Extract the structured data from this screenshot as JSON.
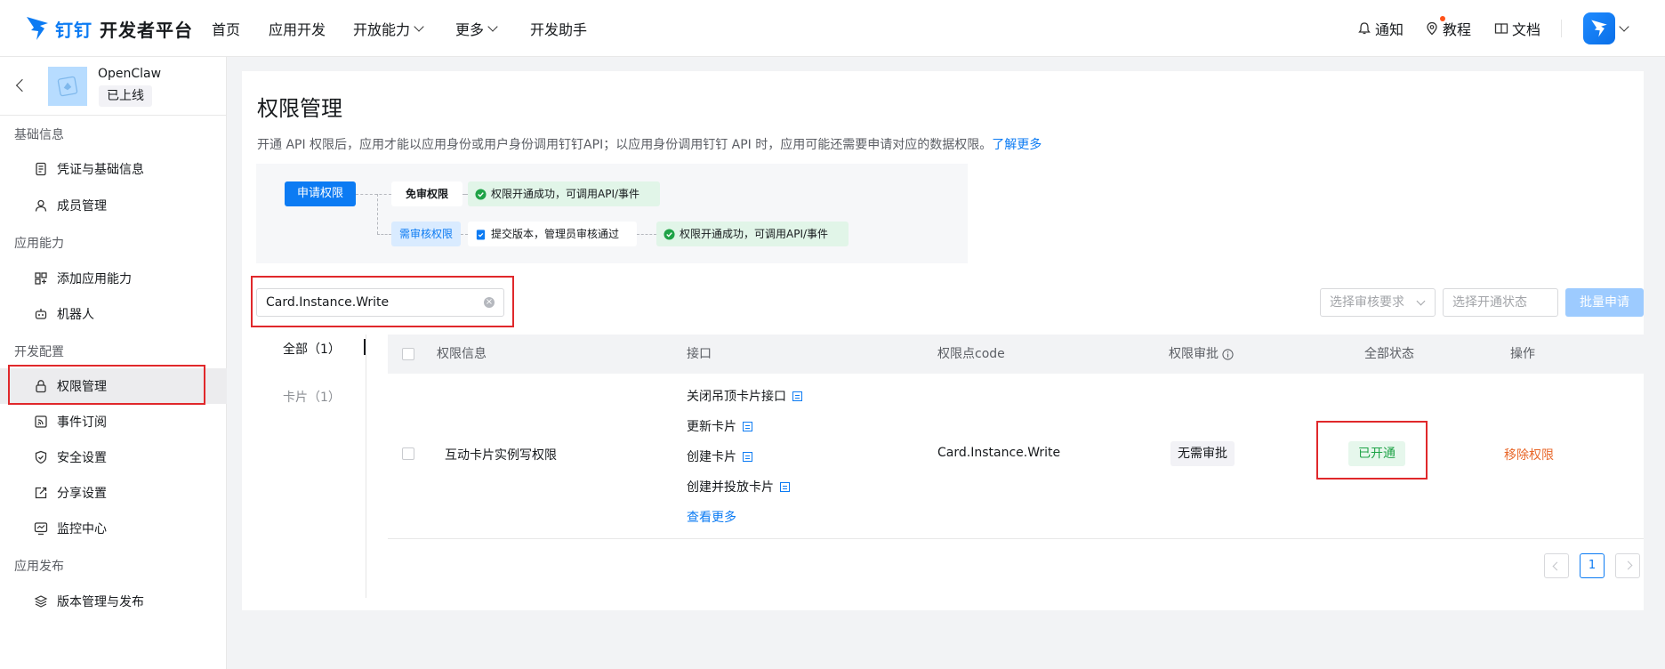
{
  "header": {
    "brand": "钉钉",
    "title": "开发者平台",
    "nav": [
      "首页",
      "应用开发",
      "开放能力",
      "更多",
      "开发助手"
    ],
    "notify": "通知",
    "tutorial": "教程",
    "docs": "文档"
  },
  "app": {
    "name": "OpenClaw",
    "status": "已上线"
  },
  "sidebar": {
    "groups": [
      {
        "title": "基础信息",
        "items": [
          "凭证与基础信息",
          "成员管理"
        ]
      },
      {
        "title": "应用能力",
        "items": [
          "添加应用能力",
          "机器人"
        ]
      },
      {
        "title": "开发配置",
        "items": [
          "权限管理",
          "事件订阅",
          "安全设置",
          "分享设置",
          "监控中心"
        ]
      },
      {
        "title": "应用发布",
        "items": [
          "版本管理与发布"
        ]
      }
    ]
  },
  "main": {
    "title": "权限管理",
    "desc": "开通 API 权限后，应用才能以应用身份或用户身份调用钉钉API；以应用身份调用钉钉 API 时，应用可能还需要申请对应的数据权限。",
    "learn_more": "了解更多",
    "flow": {
      "apply": "申请权限",
      "no_review": "免审权限",
      "success": "权限开通成功，可调用API/事件",
      "need_review": "需审核权限",
      "submit": "提交版本，管理员审核通过"
    },
    "search_value": "Card.Instance.Write",
    "filter_review": "选择审核要求",
    "filter_status": "选择开通状态",
    "batch_apply": "批量申请",
    "categories": [
      "全部（1）",
      "卡片（1）"
    ],
    "columns": [
      "权限信息",
      "接口",
      "权限点code",
      "权限审批",
      "全部状态",
      "操作"
    ],
    "rows": [
      {
        "name": "互动卡片实例写权限",
        "apis": [
          "关闭吊顶卡片接口",
          "更新卡片",
          "创建卡片",
          "创建并投放卡片"
        ],
        "view_more": "查看更多",
        "code": "Card.Instance.Write",
        "approval": "无需审批",
        "status": "已开通",
        "action": "移除权限"
      }
    ],
    "page": "1"
  },
  "colors": {
    "primary": "#0c7bf3",
    "success": "#1fa347",
    "danger_action": "#e8672a",
    "highlight": "#e0282b"
  }
}
